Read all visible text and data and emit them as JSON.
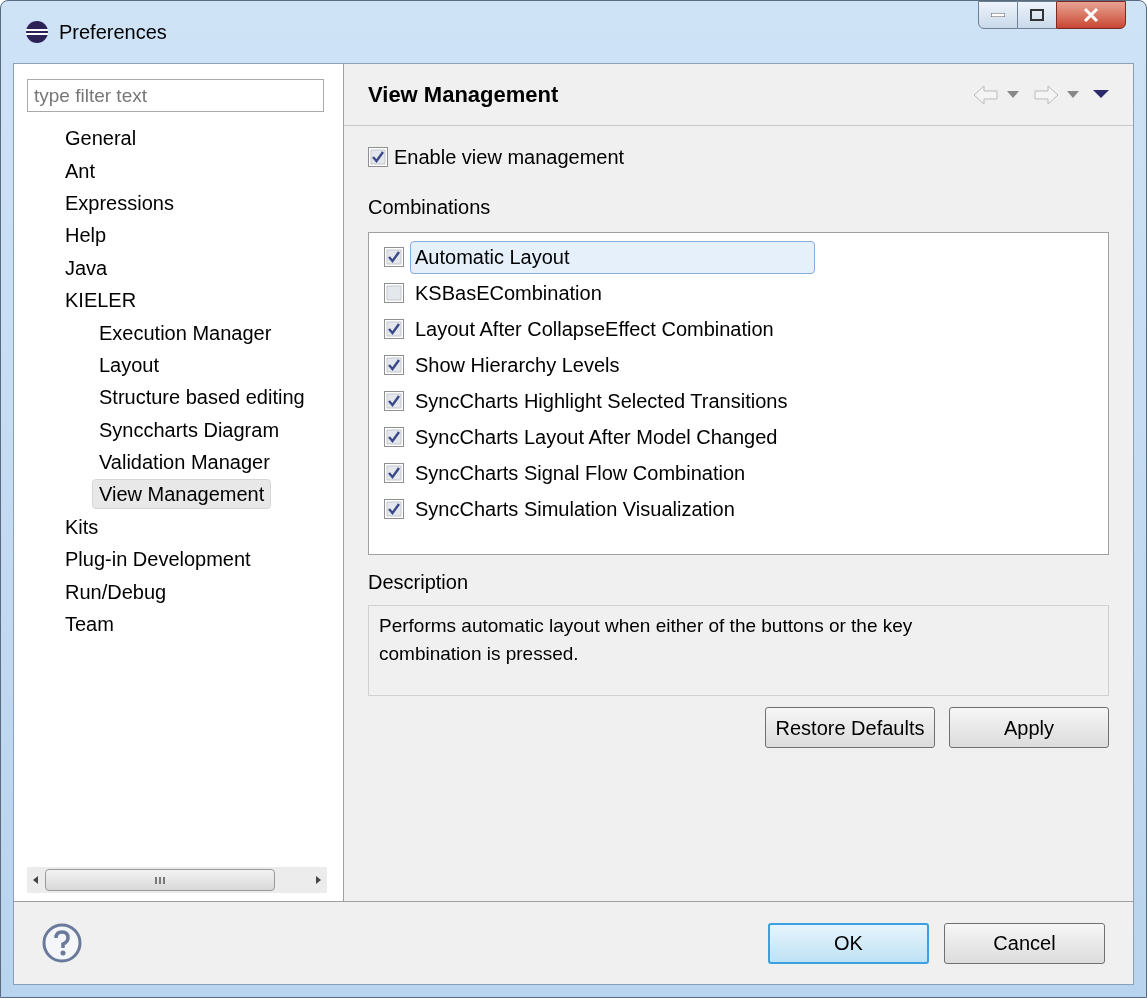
{
  "window": {
    "title": "Preferences"
  },
  "filter": {
    "placeholder": "type filter text"
  },
  "tree": [
    {
      "label": "General",
      "selected": false
    },
    {
      "label": "Ant",
      "selected": false
    },
    {
      "label": "Expressions",
      "selected": false
    },
    {
      "label": "Help",
      "selected": false
    },
    {
      "label": "Java",
      "selected": false
    },
    {
      "label": "KIELER",
      "selected": false,
      "children": [
        {
          "label": "Execution Manager",
          "selected": false
        },
        {
          "label": "Layout",
          "selected": false
        },
        {
          "label": "Structure based editing",
          "selected": false
        },
        {
          "label": "Synccharts Diagram",
          "selected": false
        },
        {
          "label": "Validation Manager",
          "selected": false
        },
        {
          "label": "View Management",
          "selected": true
        }
      ]
    },
    {
      "label": "Kits",
      "selected": false
    },
    {
      "label": "Plug-in Development",
      "selected": false
    },
    {
      "label": "Run/Debug",
      "selected": false
    },
    {
      "label": "Team",
      "selected": false
    }
  ],
  "page": {
    "title": "View Management",
    "enable": {
      "label": "Enable view management",
      "checked": true
    },
    "combinations_label": "Combinations",
    "combinations": [
      {
        "label": "Automatic Layout",
        "checked": true,
        "selected": true
      },
      {
        "label": "KSBasECombination",
        "checked": false,
        "selected": false
      },
      {
        "label": "Layout After CollapseEffect Combination",
        "checked": true,
        "selected": false
      },
      {
        "label": "Show Hierarchy Levels",
        "checked": true,
        "selected": false
      },
      {
        "label": "SyncCharts Highlight Selected Transitions",
        "checked": true,
        "selected": false
      },
      {
        "label": "SyncCharts Layout After Model Changed",
        "checked": true,
        "selected": false
      },
      {
        "label": "SyncCharts Signal Flow Combination",
        "checked": true,
        "selected": false
      },
      {
        "label": "SyncCharts Simulation Visualization",
        "checked": true,
        "selected": false
      }
    ],
    "description_label": "Description",
    "description": "Performs automatic layout when either of the buttons or the key combination is pressed.",
    "buttons": [
      "Restore Defaults",
      "Apply"
    ]
  },
  "dialog_buttons": [
    {
      "label": "OK",
      "default": true
    },
    {
      "label": "Cancel",
      "default": false
    }
  ]
}
